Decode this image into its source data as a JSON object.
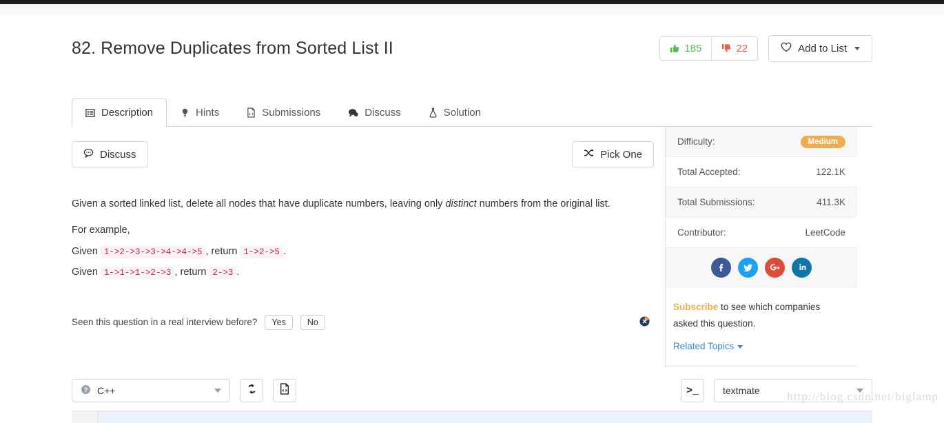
{
  "header": {
    "title": "82. Remove Duplicates from Sorted List II",
    "upvotes": "185",
    "downvotes": "22",
    "add_to_list_label": "Add to List"
  },
  "tabs": [
    {
      "label": "Description",
      "icon": "list-icon",
      "active": true
    },
    {
      "label": "Hints",
      "icon": "lightbulb-icon",
      "active": false
    },
    {
      "label": "Submissions",
      "icon": "file-code-icon",
      "active": false
    },
    {
      "label": "Discuss",
      "icon": "chat-icon",
      "active": false
    },
    {
      "label": "Solution",
      "icon": "flask-icon",
      "active": false
    }
  ],
  "toolbar": {
    "discuss_label": "Discuss",
    "pick_one_label": "Pick One"
  },
  "description": {
    "intro_before": "Given a sorted linked list, delete all nodes that have duplicate numbers, leaving only ",
    "intro_italic": "distinct",
    "intro_after": " numbers from the original list.",
    "for_example": "For example,",
    "examples": [
      {
        "given_label": "Given",
        "input": "1->2->3->3->4->4->5",
        "return_label": ", return",
        "output": "1->2->5",
        "period": "."
      },
      {
        "given_label": "Given",
        "input": "1->1->1->2->3",
        "return_label": ", return",
        "output": "2->3",
        "period": "."
      }
    ]
  },
  "interview": {
    "question": "Seen this question in a real interview before?",
    "yes_label": "Yes",
    "no_label": "No"
  },
  "sidebar": {
    "stats": [
      {
        "label": "Difficulty:",
        "value": "Medium",
        "is_badge": true
      },
      {
        "label": "Total Accepted:",
        "value": "122.1K",
        "is_badge": false
      },
      {
        "label": "Total Submissions:",
        "value": "411.3K",
        "is_badge": false
      },
      {
        "label": "Contributor:",
        "value": "LeetCode",
        "is_badge": false
      }
    ],
    "social": [
      {
        "name": "facebook",
        "color": "#3b5998"
      },
      {
        "name": "twitter",
        "color": "#1da1f2"
      },
      {
        "name": "googleplus",
        "color": "#dd4b39"
      },
      {
        "name": "linkedin",
        "color": "#0e76a8"
      }
    ],
    "subscribe_link": "Subscribe",
    "subscribe_text": " to see which companies asked this question.",
    "related_topics": "Related Topics"
  },
  "editor": {
    "language": "C++",
    "theme": "textmate",
    "reset_icon": "refresh-icon",
    "fullscreen_icon": "file-code-icon",
    "console_icon": "console-icon"
  },
  "watermark": "http://blog.csdn.net/biglamp",
  "colors": {
    "difficulty_medium": "#f0ad4e",
    "upvote_green": "#5cb85c",
    "downvote_red": "#e8614d",
    "code_pink": "#c7254e",
    "link_blue": "#3a87c8"
  }
}
